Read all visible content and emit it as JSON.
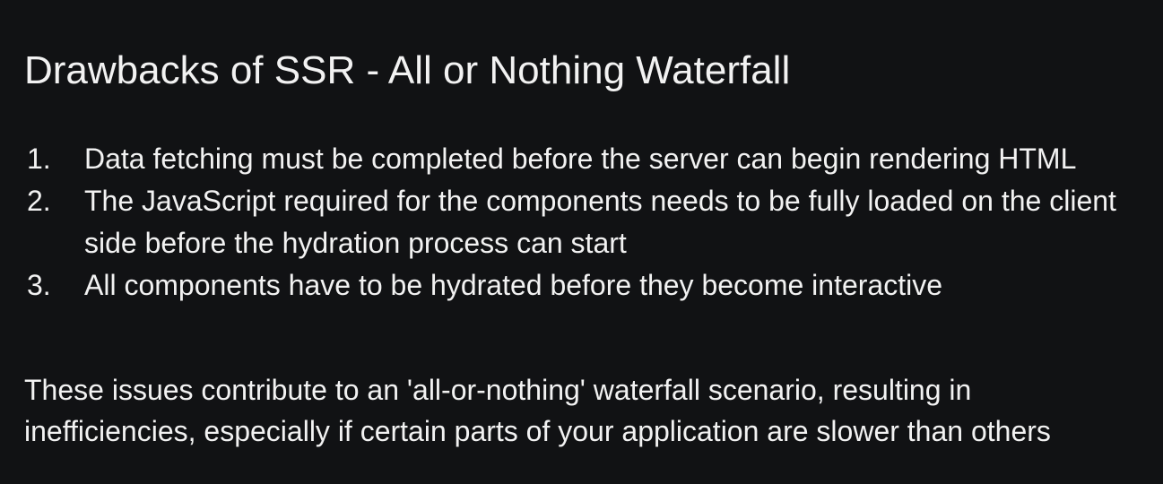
{
  "slide": {
    "title": "Drawbacks of SSR - All or Nothing Waterfall",
    "list": [
      {
        "number": "1.",
        "text": "Data fetching must be completed before the server can begin rendering HTML"
      },
      {
        "number": "2.",
        "text": "The JavaScript required for the components needs to be fully loaded on the client side before the hydration process can start"
      },
      {
        "number": "3.",
        "text": "All components have to be hydrated before they become interactive"
      }
    ],
    "summary": "These issues contribute to an 'all-or-nothing' waterfall scenario, resulting in inefficiencies, especially if certain parts of your application are slower than others"
  },
  "colors": {
    "background": "#111214",
    "text": "#f2f2f2"
  }
}
